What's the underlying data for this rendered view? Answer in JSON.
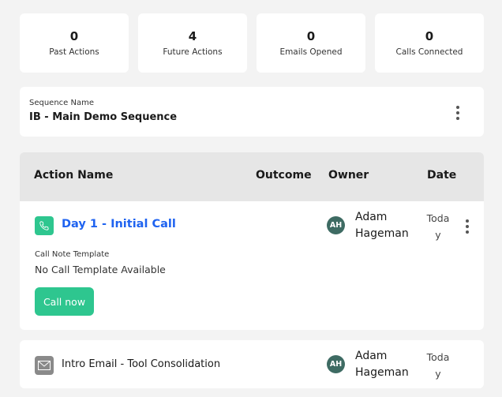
{
  "stats": [
    {
      "value": "0",
      "label": "Past Actions"
    },
    {
      "value": "4",
      "label": "Future Actions"
    },
    {
      "value": "0",
      "label": "Emails Opened"
    },
    {
      "value": "0",
      "label": "Calls Connected"
    }
  ],
  "sequence": {
    "label": "Sequence Name",
    "name": "IB - Main Demo Sequence"
  },
  "table": {
    "headers": {
      "action": "Action Name",
      "outcome": "Outcome",
      "owner": "Owner",
      "date": "Date"
    },
    "rows": [
      {
        "icon": "phone-icon",
        "title": "Day 1 - Initial Call",
        "note_label": "Call Note Template",
        "note_value": "No Call Template Available",
        "button": "Call now",
        "owner_initials": "AH",
        "owner": "Adam Hageman",
        "date": "Today"
      },
      {
        "icon": "mail-icon",
        "title": "Intro Email - Tool Consolidation",
        "owner_initials": "AH",
        "owner": "Adam Hageman",
        "date": "Today"
      }
    ]
  },
  "colors": {
    "accent": "#1f63f0",
    "green": "#2ec68f",
    "avatar": "#3e6b63"
  }
}
